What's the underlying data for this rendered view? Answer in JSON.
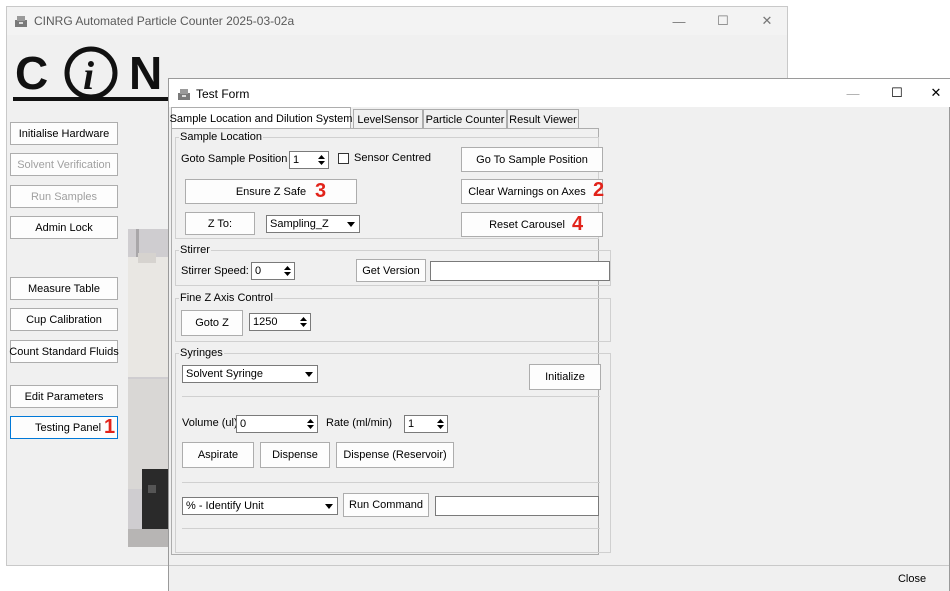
{
  "colors": {
    "accent": "#0078d7",
    "badge": "#e2231a"
  },
  "main_window": {
    "title": "CINRG Automated Particle Counter 2025-03-02a",
    "icon": "app-icon",
    "controls": [
      "minimize-icon",
      "maximize-icon",
      "close-icon"
    ],
    "logo_text": "CINRG",
    "buttons": [
      {
        "label": "Initialise Hardware",
        "enabled": true
      },
      {
        "label": "Solvent Verification",
        "enabled": false
      },
      {
        "label": "Run Samples",
        "enabled": false
      },
      {
        "label": "Admin Lock",
        "enabled": true
      },
      {
        "label": "Measure Table",
        "enabled": true
      },
      {
        "label": "Cup Calibration",
        "enabled": true
      },
      {
        "label": "Count Standard Fluids",
        "enabled": true
      },
      {
        "label": "Edit Parameters",
        "enabled": true
      },
      {
        "label": "Testing Panel",
        "enabled": true,
        "badge": "1"
      }
    ]
  },
  "test_form": {
    "title": "Test Form",
    "tabs": [
      "Sample Location and Dilution System",
      "LevelSensor",
      "Particle Counter",
      "Result Viewer"
    ],
    "active_tab": "Sample Location and Dilution System",
    "sample_location": {
      "group_label": "Sample Location",
      "goto_label": "Goto Sample Position",
      "goto_value": "1",
      "sensor_centred_label": "Sensor Centred",
      "sensor_centred_checked": false,
      "goto_button": "Go To Sample Position",
      "ensure_z_safe": "Ensure Z Safe",
      "ensure_badge": "3",
      "clear_warnings": "Clear Warnings on Axes",
      "clear_badge": "2",
      "z_to_button": "Z To:",
      "z_to_value": "Sampling_Z",
      "reset_carousel": "Reset Carousel",
      "reset_badge": "4"
    },
    "stirrer": {
      "group_label": "Stirrer",
      "speed_label": "Stirrer Speed:",
      "speed_value": "0",
      "get_version": "Get Version",
      "version_text": ""
    },
    "fine_z": {
      "group_label": "Fine Z Axis Control",
      "goto_z": "Goto Z",
      "z_value": "1250"
    },
    "syringes": {
      "group_label": "Syringes",
      "syringe_select": "Solvent Syringe",
      "initialize": "Initialize",
      "volume_label": "Volume (ul)",
      "volume_value": "0",
      "rate_label": "Rate (ml/min)",
      "rate_value": "1",
      "aspirate": "Aspirate",
      "dispense": "Dispense",
      "dispense_reservoir": "Dispense (Reservoir)",
      "command_select": "% - Identify Unit",
      "run_command": "Run Command",
      "command_text": ""
    },
    "close_button": "Close"
  }
}
